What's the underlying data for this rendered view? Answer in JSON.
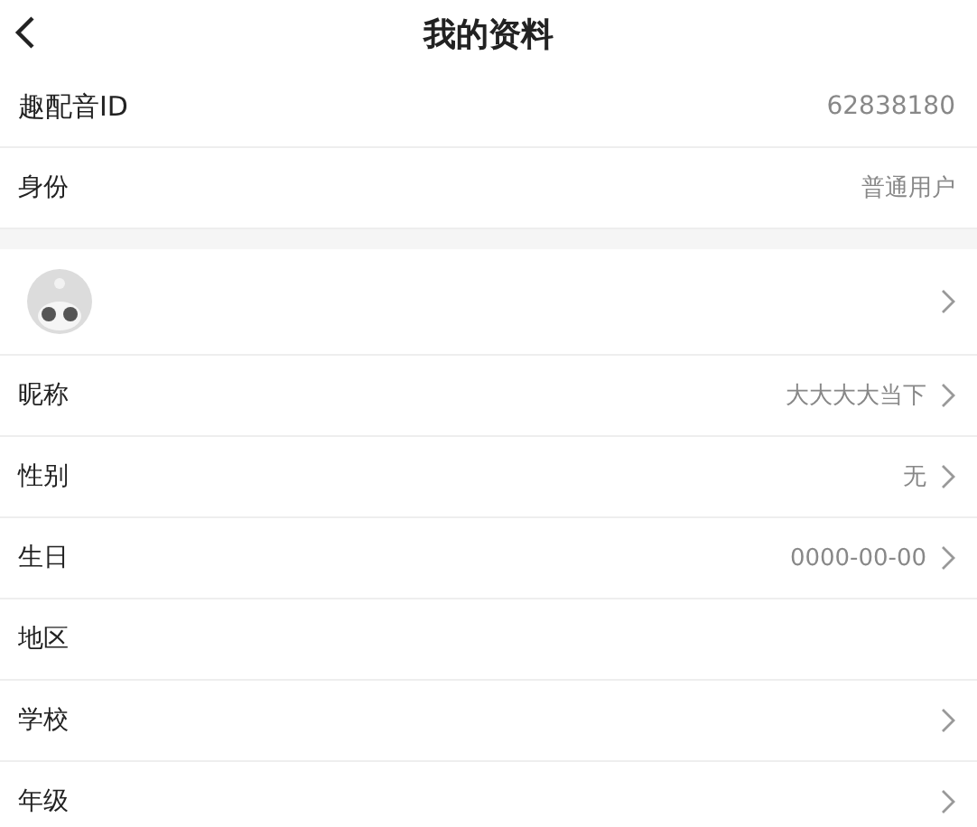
{
  "header": {
    "title": "我的资料"
  },
  "account_rows": [
    {
      "label": "趣配音ID",
      "value": "62838180",
      "kind": "id"
    },
    {
      "label": "身份",
      "value": "普通用户",
      "kind": "plain"
    }
  ],
  "avatar_row": {
    "chevron": true
  },
  "profile_rows": [
    {
      "label": "昵称",
      "value": "大大大大当下",
      "chevron": true
    },
    {
      "label": "性别",
      "value": "无",
      "chevron": true
    },
    {
      "label": "生日",
      "value": "0000-00-00",
      "chevron": true
    },
    {
      "label": "地区",
      "chevron": false
    },
    {
      "label": "学校",
      "chevron": true
    },
    {
      "label": "年级",
      "chevron": true
    }
  ]
}
